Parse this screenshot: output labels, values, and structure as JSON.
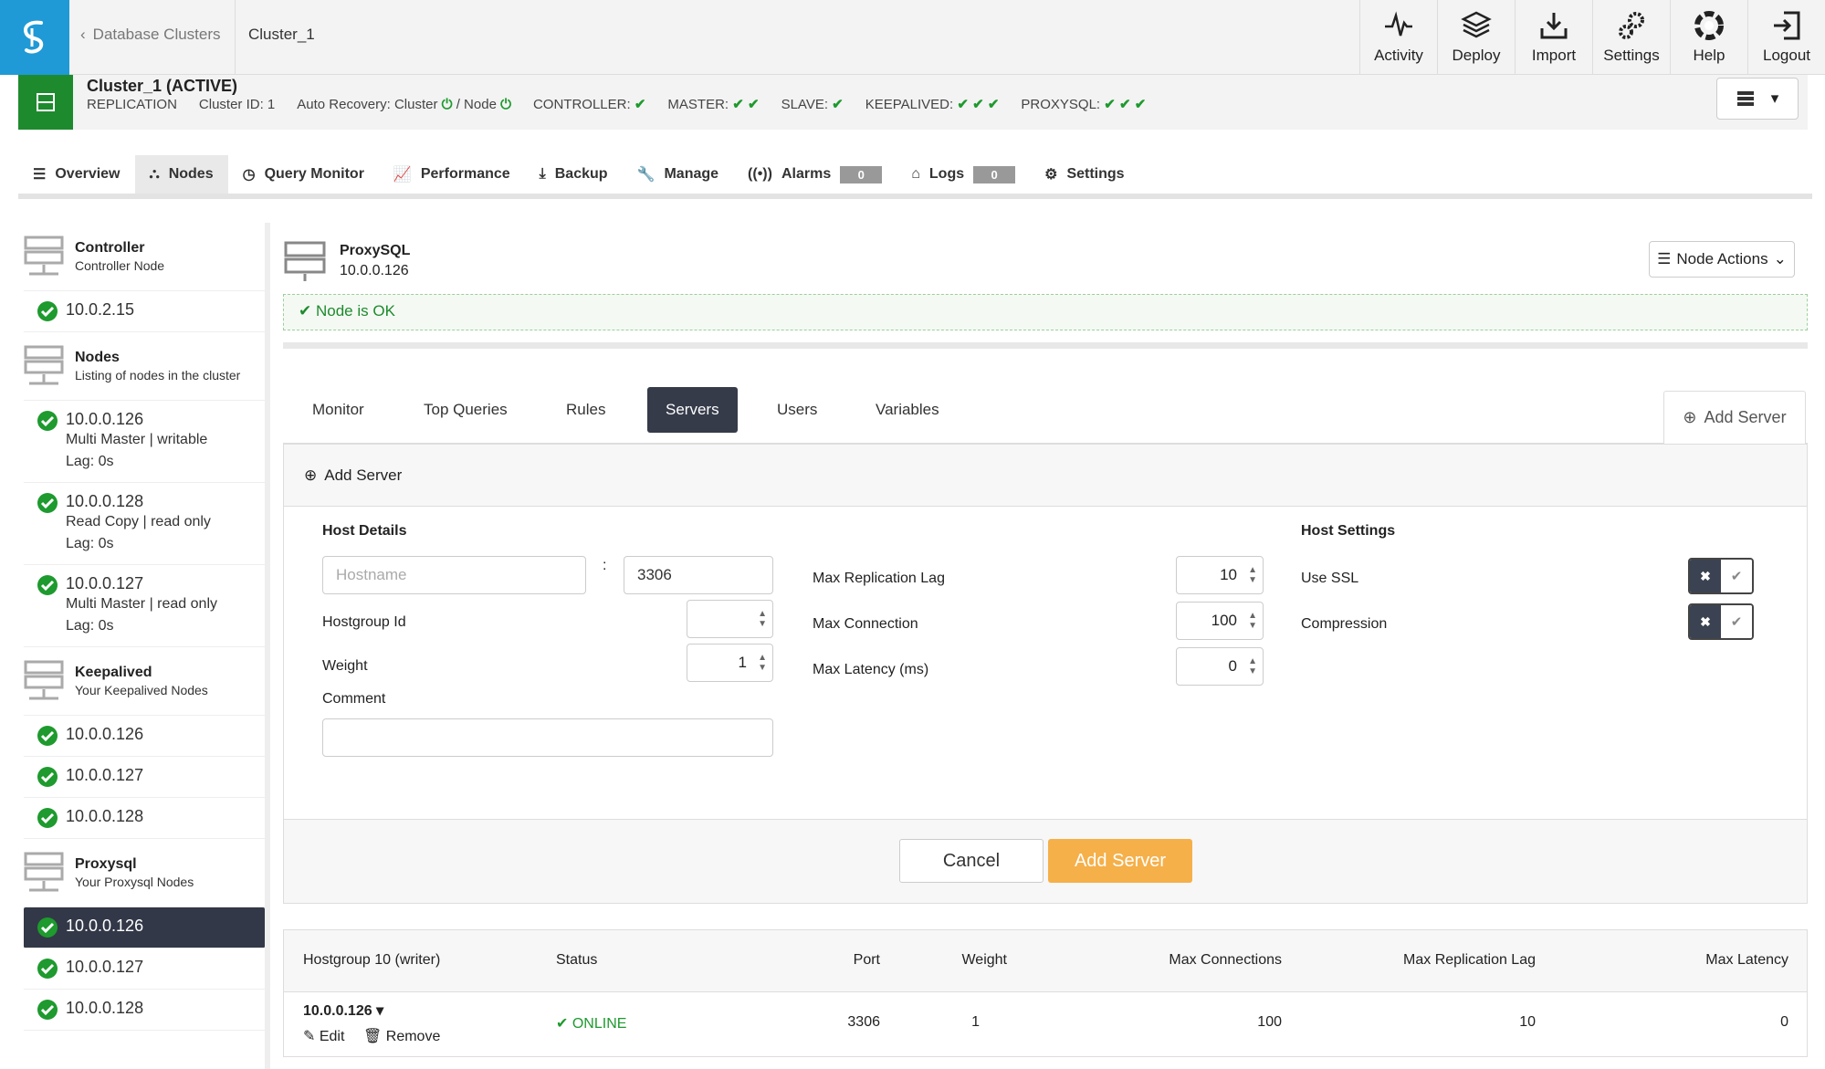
{
  "topbar": {
    "back_label": "Database Clusters",
    "current": "Cluster_1",
    "nav": [
      {
        "label": "Activity",
        "icon": "activity-icon"
      },
      {
        "label": "Deploy",
        "icon": "deploy-icon"
      },
      {
        "label": "Import",
        "icon": "import-icon"
      },
      {
        "label": "Settings",
        "icon": "gears-icon"
      },
      {
        "label": "Help",
        "icon": "lifebuoy-icon"
      },
      {
        "label": "Logout",
        "icon": "logout-icon"
      }
    ]
  },
  "cluster": {
    "title": "Cluster_1 (ACTIVE)",
    "type": "REPLICATION",
    "cluster_id": "Cluster ID: 1",
    "auto_recovery": "Auto Recovery: Cluster",
    "auto_recovery_node": "/ Node",
    "controller": "CONTROLLER:",
    "master": "MASTER:",
    "slave": "SLAVE:",
    "keepalived": "KEEPALIVED:",
    "proxysql": "PROXYSQL:"
  },
  "tabs": [
    {
      "label": "Overview"
    },
    {
      "label": "Nodes"
    },
    {
      "label": "Query Monitor"
    },
    {
      "label": "Performance"
    },
    {
      "label": "Backup"
    },
    {
      "label": "Manage"
    },
    {
      "label": "Alarms",
      "badge": "0"
    },
    {
      "label": "Logs",
      "badge": "0"
    },
    {
      "label": "Settings"
    }
  ],
  "sidebar": {
    "controller": {
      "title": "Controller",
      "subtitle": "Controller Node",
      "ip": "10.0.2.15"
    },
    "nodes": {
      "title": "Nodes",
      "subtitle": "Listing of nodes in the cluster",
      "items": [
        {
          "ip": "10.0.0.126",
          "role": "Multi Master | writable",
          "lag": "Lag: 0s"
        },
        {
          "ip": "10.0.0.128",
          "role": "Read Copy | read only",
          "lag": "Lag: 0s"
        },
        {
          "ip": "10.0.0.127",
          "role": "Multi Master | read only",
          "lag": "Lag: 0s"
        }
      ]
    },
    "keepalived": {
      "title": "Keepalived",
      "subtitle": "Your Keepalived Nodes",
      "items": [
        "10.0.0.126",
        "10.0.0.127",
        "10.0.0.128"
      ]
    },
    "proxysql": {
      "title": "Proxysql",
      "subtitle": "Your Proxysql Nodes",
      "items": [
        "10.0.0.126",
        "10.0.0.127",
        "10.0.0.128"
      ]
    }
  },
  "node": {
    "name": "ProxySQL",
    "ip": "10.0.0.126",
    "actions_label": "Node Actions",
    "status": "Node is OK"
  },
  "subtabs": [
    "Monitor",
    "Top Queries",
    "Rules",
    "Servers",
    "Users",
    "Variables"
  ],
  "add_server_tab": "Add Server",
  "form": {
    "title": "Add Server",
    "host_details": "Host Details",
    "hostname_placeholder": "Hostname",
    "colon": ":",
    "port": "3306",
    "hostgroup_label": "Hostgroup Id",
    "hostgroup_value": "",
    "weight_label": "Weight",
    "weight_value": "1",
    "comment_label": "Comment",
    "comment_value": "",
    "max_replication_lag_label": "Max Replication Lag",
    "max_replication_lag": "10",
    "max_connection_label": "Max Connection",
    "max_connection": "100",
    "max_latency_label": "Max Latency (ms)",
    "max_latency": "0",
    "host_settings": "Host Settings",
    "use_ssl_label": "Use SSL",
    "compression_label": "Compression",
    "cancel": "Cancel",
    "submit": "Add Server"
  },
  "table": {
    "headers": [
      "Hostgroup 10 (writer)",
      "Status",
      "Port",
      "Weight",
      "Max Connections",
      "Max Replication Lag",
      "Max Latency"
    ],
    "rows": [
      {
        "host": "10.0.0.126",
        "edit": "Edit",
        "remove": "Remove",
        "status": "ONLINE",
        "port": "3306",
        "weight": "1",
        "max_connections": "100",
        "max_replication_lag": "10",
        "max_latency": "0"
      }
    ]
  },
  "colors": {
    "brand": "#1f9ad6",
    "ok": "#1e9a2e",
    "cluster_active": "#1e8a2e",
    "primary_button": "#f5b04a",
    "dark": "#363b4a"
  }
}
